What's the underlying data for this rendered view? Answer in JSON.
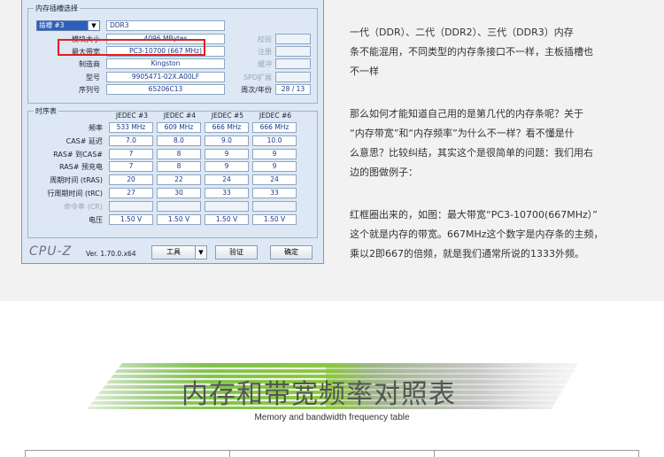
{
  "cpuz": {
    "slot_section_title": "内存插槽选择",
    "slot_selected": "插槽 #3",
    "memory_type": "DDR3",
    "rows": [
      {
        "label": "模块大小",
        "value": "4096 MBytes",
        "right_label": "校验",
        "right_value": ""
      },
      {
        "label": "最大带宽",
        "value": "PC3-10700 (667 MHz)",
        "right_label": "注册",
        "right_value": ""
      },
      {
        "label": "制造商",
        "value": "Kingston",
        "right_label": "缓冲",
        "right_value": ""
      },
      {
        "label": "型号",
        "value": "9905471-02X.A00LF",
        "right_label": "SPD扩展",
        "right_value": ""
      },
      {
        "label": "序列号",
        "value": "65206C13",
        "right_label": "周次/年份",
        "right_value": "28 / 13"
      }
    ],
    "timing_section_title": "时序表",
    "timing_columns": [
      "JEDEC #3",
      "JEDEC #4",
      "JEDEC #5",
      "JEDEC #6"
    ],
    "timing_rows": [
      {
        "label": "频率",
        "values": [
          "533 MHz",
          "609 MHz",
          "666 MHz",
          "666 MHz"
        ]
      },
      {
        "label": "CAS# 延迟",
        "values": [
          "7.0",
          "8.0",
          "9.0",
          "10.0"
        ]
      },
      {
        "label": "RAS# 到CAS#",
        "values": [
          "7",
          "8",
          "9",
          "9"
        ]
      },
      {
        "label": "RAS# 预充电",
        "values": [
          "7",
          "8",
          "9",
          "9"
        ]
      },
      {
        "label": "周期时间 (tRAS)",
        "values": [
          "20",
          "22",
          "24",
          "24"
        ]
      },
      {
        "label": "行周期时间 (tRC)",
        "values": [
          "27",
          "30",
          "33",
          "33"
        ]
      },
      {
        "label": "命令率 (CR)",
        "values": [
          "",
          "",
          "",
          ""
        ]
      },
      {
        "label": "电压",
        "values": [
          "1.50 V",
          "1.50 V",
          "1.50 V",
          "1.50 V"
        ]
      }
    ],
    "logo": "CPU-Z",
    "version": "Ver. 1.70.0.x64",
    "tools_label": "工具",
    "validate_label": "验证",
    "ok_label": "确定"
  },
  "paragraphs": [
    [
      "一代（DDR）、二代（DDR2）、三代（DDR3）内存",
      "条不能混用，不同类型的内存条接口不一样，主板插槽也",
      "不一样"
    ],
    [
      "那么如何才能知道自己用的是第几代的内存条呢？关于",
      "“内存带宽”和“内存频率”为什么不一样？看不懂是什",
      "么意思？比较纠结，其实这个是很简单的问题：我们用右",
      "边的图做例子："
    ],
    [
      "红框圈出来的，如图：最大带宽“PC3-10700(667MHz）”",
      "这个就是内存的带宽。667MHz这个数字是内存条的主频，",
      "乘以2即667的倍频，就是我们通常所说的1333外频。"
    ]
  ],
  "banner": {
    "title": "内存和带宽频率对照表",
    "subtitle": "Memory and bandwidth frequency table",
    "accent_color": "#8cc63f"
  }
}
